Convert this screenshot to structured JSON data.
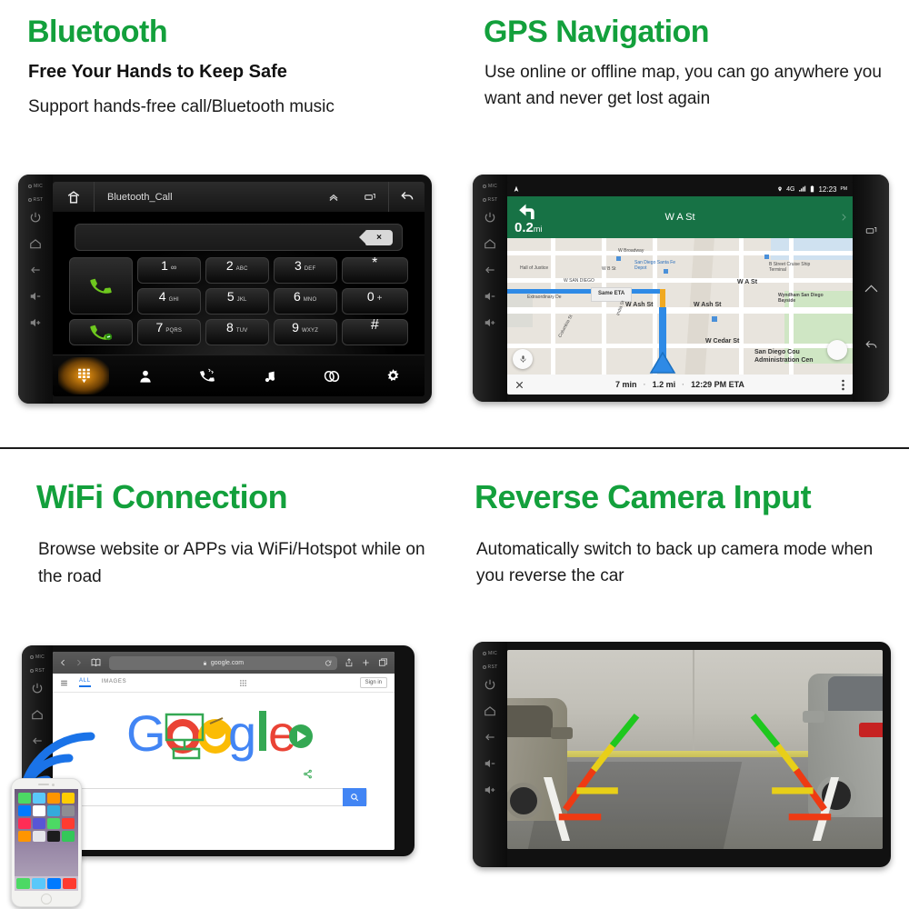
{
  "panels": {
    "bluetooth": {
      "title": "Bluetooth",
      "subtitle": "Free Your Hands to Keep Safe",
      "body": "Support hands-free call/Bluetooth music",
      "screen": {
        "app_title": "Bluetooth_Call",
        "home_icon": "home-icon",
        "titlebar_icons": [
          "chevron-up-icon",
          "recents-icon",
          "back-icon"
        ],
        "input_value": "",
        "delete_icon": "backspace-icon",
        "keys": [
          {
            "digit": "1",
            "letters": "∞"
          },
          {
            "digit": "2",
            "letters": "ABC"
          },
          {
            "digit": "3",
            "letters": "DEF"
          },
          {
            "digit": "*",
            "letters": ""
          },
          {
            "digit": "4",
            "letters": "GHI"
          },
          {
            "digit": "5",
            "letters": "JKL"
          },
          {
            "digit": "6",
            "letters": "MNO"
          },
          {
            "digit": "0",
            "letters": "+"
          },
          {
            "digit": "7",
            "letters": "PQRS"
          },
          {
            "digit": "8",
            "letters": "TUV"
          },
          {
            "digit": "9",
            "letters": "WXYZ"
          },
          {
            "digit": "#",
            "letters": ""
          }
        ],
        "call_button": "call-icon",
        "hangup_button": "end-call-icon",
        "dock": [
          "dialpad-icon",
          "contacts-icon",
          "call-history-icon",
          "music-icon",
          "link-icon",
          "settings-icon"
        ],
        "dock_active": "dialpad-icon"
      },
      "bezel": {
        "labels": [
          "MIC",
          "RST"
        ],
        "icons": [
          "power-icon",
          "home-icon",
          "back-icon",
          "volume-down-icon",
          "volume-up-icon"
        ]
      }
    },
    "gps": {
      "title": "GPS Navigation",
      "body": "Use online or offline map, you can go anywhere you want and never get lost again",
      "screen": {
        "status": {
          "network": "4G",
          "time": "12:23",
          "period": "PM",
          "icons": [
            "navigation-arrow-icon",
            "location-pin-icon",
            "signal-icon",
            "battery-icon"
          ]
        },
        "maneuver": {
          "distance": "0.2",
          "unit": "mi",
          "direction": "turn-left-icon"
        },
        "street": "W A St",
        "bottom": {
          "duration": "7 min",
          "distance": "1.2 mi",
          "eta": "12:29 PM ETA",
          "close_icon": "close-icon",
          "more_icon": "more-vertical-icon"
        },
        "map_labels": [
          "W Broadway",
          "W SAN DIEGO",
          "W B St",
          "W A St",
          "W Ash St",
          "W Ash St",
          "W Cedar St",
          "San Diego Santa Fe Depot",
          "B Street Cruise Ship Terminal",
          "Wyndham San Diego Bayside",
          "Extraordinary De",
          "San Diego Cou Administration Cen",
          "India St",
          "Columbia St",
          "Hall of Justice"
        ],
        "callout": "Same ETA",
        "mic_icon": "microphone-icon"
      },
      "bezel_right": [
        "recents-icon",
        "home-icon",
        "back-icon"
      ]
    },
    "wifi": {
      "title": "WiFi Connection",
      "body": "Browse website or APPs via WiFi/Hotspot while on the road",
      "screen": {
        "browser": {
          "url": "google.com",
          "lock_icon": "lock-icon",
          "nav_icons": [
            "back-arrow-icon",
            "forward-arrow-icon",
            "bookmarks-icon"
          ],
          "action_icons": [
            "reload-icon",
            "share-icon",
            "new-tab-icon",
            "tabs-icon"
          ]
        },
        "tabs": [
          "ALL",
          "IMAGES"
        ],
        "active_tab": "ALL",
        "menu_icon": "hamburger-menu-icon",
        "apps_icon": "apps-grid-icon",
        "signin": "Sign in",
        "logo": "google-doodle-logo",
        "play_icon": "play-button-icon",
        "share_icon": "share-icon",
        "search_icon": "search-icon"
      },
      "overlay": {
        "wifi_icon": "wifi-signal-icon",
        "phone": "iphone-device"
      }
    },
    "camera": {
      "title": "Reverse Camera Input",
      "body": "Automatically switch to back up camera mode when you reverse the car",
      "screen": {
        "guide_colors": {
          "near": "#ee3a13",
          "mid": "#e8cf18",
          "far": "#1ec81e"
        },
        "scene": [
          "parked-car-left",
          "parked-car-right",
          "concrete-wall",
          "parking-lines"
        ]
      }
    }
  },
  "colors": {
    "heading_green": "#13a03c",
    "body_black": "#1a1a1a",
    "divider": "#1b1b1b"
  }
}
